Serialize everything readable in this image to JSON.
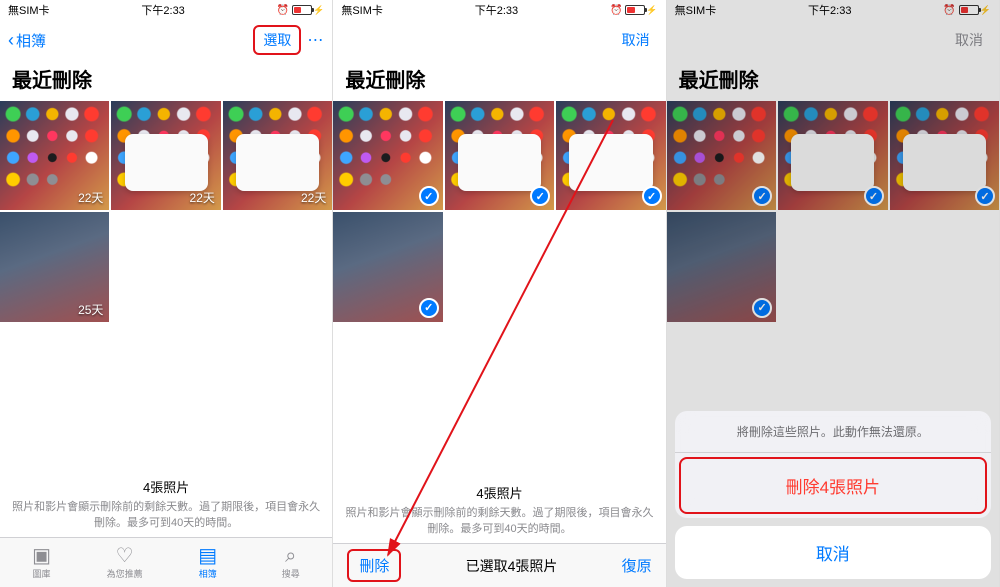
{
  "status": {
    "carrier": "無SIM卡",
    "time": "下午2:33",
    "alarm_icon": "alarm-icon",
    "battery_icon": "battery-low-charging-icon"
  },
  "phone1": {
    "nav": {
      "back_label": "相簿",
      "select_label": "選取",
      "more_label": "⋯"
    },
    "title": "最近刪除",
    "thumbs": [
      {
        "days": "22天"
      },
      {
        "days": "22天"
      },
      {
        "days": "22天"
      },
      {
        "days": "25天"
      }
    ],
    "footer": {
      "count": "4張照片",
      "desc": "照片和影片會顯示刪除前的剩餘天數。過了期限後，項目會永久刪除。最多可到40天的時間。"
    },
    "tabs": [
      {
        "label": "圖庫"
      },
      {
        "label": "為您推薦"
      },
      {
        "label": "相簿"
      },
      {
        "label": "搜尋"
      }
    ]
  },
  "phone2": {
    "nav": {
      "cancel_label": "取消"
    },
    "title": "最近刪除",
    "footer": {
      "count": "4張照片",
      "desc": "照片和影片會顯示刪除前的剩餘天數。過了期限後，項目會永久刪除。最多可到40天的時間。"
    },
    "toolbar": {
      "delete_label": "刪除",
      "center": "已選取4張照片",
      "restore_label": "復原"
    }
  },
  "phone3": {
    "nav": {
      "cancel_label": "取消"
    },
    "title": "最近刪除",
    "sheet": {
      "message": "將刪除這些照片。此動作無法還原。",
      "destructive": "刪除4張照片",
      "cancel": "取消"
    },
    "hidden_footer": "久刪除。最多可到40天的時間。"
  }
}
